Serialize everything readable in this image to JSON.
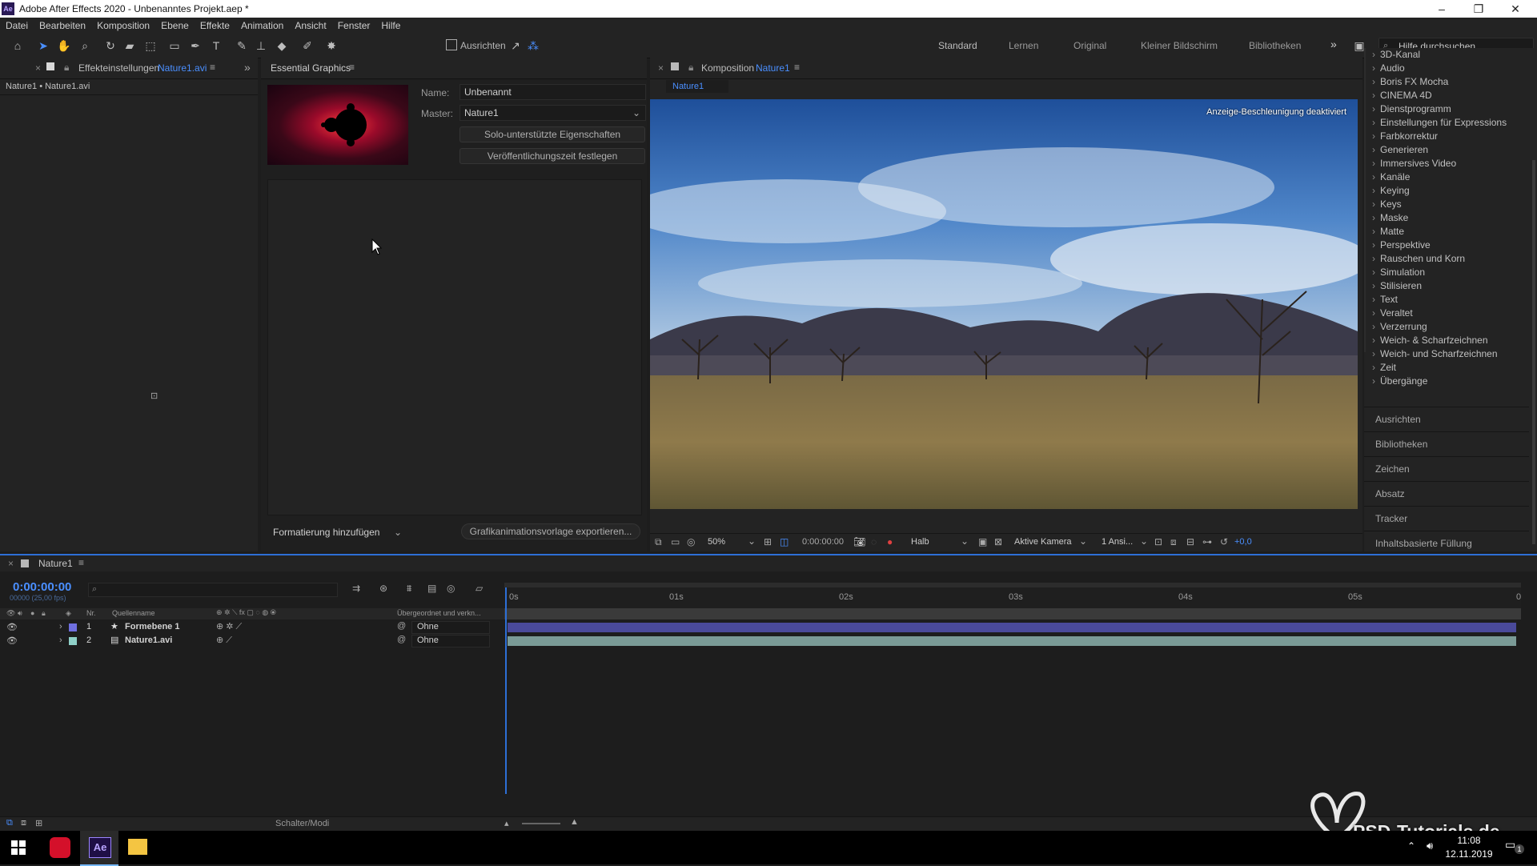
{
  "window": {
    "title": "Adobe After Effects 2020 - Unbenanntes Projekt.aep *",
    "app_icon": "Ae",
    "buttons": {
      "minimize": "–",
      "restore": "❐",
      "close": "✕"
    }
  },
  "menu": [
    "Datei",
    "Bearbeiten",
    "Komposition",
    "Ebene",
    "Effekte",
    "Animation",
    "Ansicht",
    "Fenster",
    "Hilfe"
  ],
  "toolbar": {
    "align_label": "Ausrichten",
    "workspaces": [
      "Standard",
      "Lernen",
      "Original",
      "Kleiner Bildschirm",
      "Bibliotheken"
    ],
    "more": "»",
    "search_placeholder": "Hilfe durchsuchen"
  },
  "effects_panel": {
    "tab_label": "Effekteinstellungen",
    "tab_target": "Nature1.avi",
    "breadcrumb": "Nature1 • Nature1.avi"
  },
  "essential_graphics": {
    "tab_label": "Essential Graphics",
    "name_label": "Name:",
    "name_value": "Unbenannt",
    "master_label": "Master:",
    "master_value": "Nature1",
    "solo_button": "Solo-unterstützte Eigenschaften",
    "publish_button": "Veröffentlichungszeit festlegen",
    "add_format": "Formatierung hinzufügen",
    "export_button": "Grafikanimationsvorlage exportieren..."
  },
  "composition": {
    "tab_prefix": "Komposition",
    "tab_name": "Nature1",
    "sub_tab": "Nature1",
    "overlay_text": "Anzeige-Beschleunigung deaktiviert",
    "zoom": "50%",
    "timecode": "0:00:00:00",
    "resolution": "Halb",
    "camera": "Aktive Kamera",
    "views": "1 Ansi...",
    "exposure": "+0,0"
  },
  "effects_list": [
    "3D-Kanal",
    "Audio",
    "Boris FX Mocha",
    "CINEMA 4D",
    "Dienstprogramm",
    "Einstellungen für Expressions",
    "Farbkorrektur",
    "Generieren",
    "Immersives Video",
    "Kanäle",
    "Keying",
    "Keys",
    "Maske",
    "Matte",
    "Perspektive",
    "Rauschen und Korn",
    "Simulation",
    "Stilisieren",
    "Text",
    "Veraltet",
    "Verzerrung",
    "Weich- & Scharfzeichnen",
    "Weich- und Scharfzeichnen",
    "Zeit",
    "Übergänge"
  ],
  "side_panels": [
    "Ausrichten",
    "Bibliotheken",
    "Zeichen",
    "Absatz",
    "Tracker",
    "Inhaltsbasierte Füllung"
  ],
  "timeline": {
    "tab_name": "Nature1",
    "timecode": "0:00:00:00",
    "fps": "00000 (25,00 fps)",
    "col_nr": "Nr.",
    "col_source": "Quellenname",
    "col_parent": "Übergeordnet und verkn...",
    "ticks": [
      "0s",
      "01s",
      "02s",
      "03s",
      "04s",
      "05s",
      "0"
    ],
    "switches_modes": "Schalter/Modi",
    "layers": [
      {
        "nr": "1",
        "name": "Formebene 1",
        "parent": "Ohne",
        "color": "#6f6fe0",
        "bar_color": "#4a4a9a",
        "icon": "star-icon"
      },
      {
        "nr": "2",
        "name": "Nature1.avi",
        "parent": "Ohne",
        "color": "#8fd0c8",
        "bar_color": "#7a9a96",
        "icon": "film-icon"
      }
    ]
  },
  "watermark": "PSD-Tutorials.de",
  "taskbar": {
    "time": "11:08",
    "date": "12.11.2019",
    "notification_count": "1"
  },
  "colors": {
    "accent": "#4a8fff",
    "bg": "#1d1d1d",
    "panel": "#232323"
  }
}
